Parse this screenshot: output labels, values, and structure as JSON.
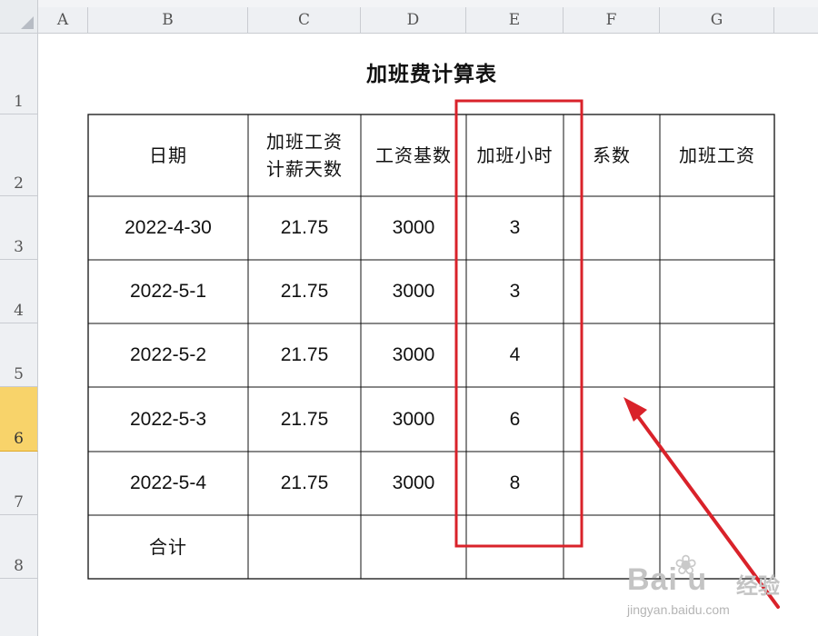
{
  "sheet": {
    "title": "加班费计算表",
    "columns": [
      "A",
      "B",
      "C",
      "D",
      "E",
      "F",
      "G"
    ],
    "rows": [
      "1",
      "2",
      "3",
      "4",
      "5",
      "6",
      "7",
      "8"
    ],
    "selected_row": "6",
    "headers": {
      "date": "日期",
      "days_line1": "加班工资",
      "days_line2": "计薪天数",
      "base": "工资基数",
      "hours": "加班小时",
      "coef": "系数",
      "pay": "加班工资"
    },
    "records": [
      {
        "date": "2022-4-30",
        "days": "21.75",
        "base": "3000",
        "hours": "3",
        "coef": "",
        "pay": ""
      },
      {
        "date": "2022-5-1",
        "days": "21.75",
        "base": "3000",
        "hours": "3",
        "coef": "",
        "pay": ""
      },
      {
        "date": "2022-5-2",
        "days": "21.75",
        "base": "3000",
        "hours": "4",
        "coef": "",
        "pay": ""
      },
      {
        "date": "2022-5-3",
        "days": "21.75",
        "base": "3000",
        "hours": "6",
        "coef": "",
        "pay": ""
      },
      {
        "date": "2022-5-4",
        "days": "21.75",
        "base": "3000",
        "hours": "8",
        "coef": "",
        "pay": ""
      }
    ],
    "total_label": "合计"
  },
  "annotations": {
    "highlight_color": "#d9222a",
    "arrow_color": "#d9222a"
  },
  "watermark": {
    "brand": "Bai  u",
    "chinese": "经验",
    "url": "jingyan.baidu.com"
  }
}
